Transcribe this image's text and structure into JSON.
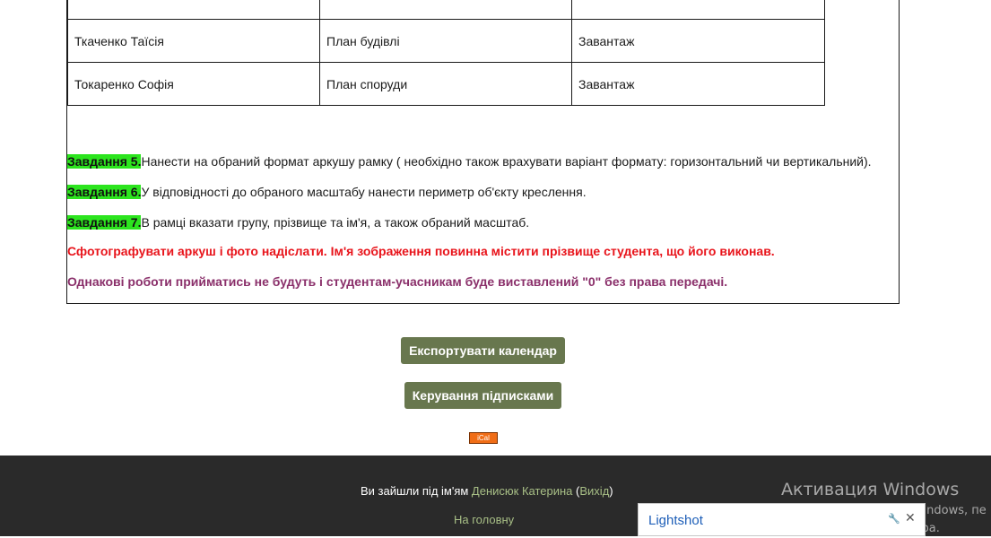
{
  "table": {
    "rows": [
      {
        "name": "",
        "task": "",
        "file": ""
      },
      {
        "name": "Ткаченко Таїсія",
        "task": "План будівлі",
        "file": "Завантаж"
      },
      {
        "name": "Токаренко Софія",
        "task": "План споруди",
        "file": "Завантаж"
      }
    ]
  },
  "tasks": [
    {
      "label": "Завдання 5.",
      "text": "Нанести на обраний формат аркушу рамку ( необхідно також врахувати варіант формату: горизонтальний чи вертикальний)."
    },
    {
      "label": "Завдання 6.",
      "text": "У відповідності до обраного масштабу нанести периметр об'єкту креслення."
    },
    {
      "label": "Завдання 7.",
      "text": "В рамці вказати групу, прізвище та ім'я, а також обраний масштаб."
    }
  ],
  "notes": {
    "red": "Сфотографувати аркуш і фото надіслати. Ім'я  зображення повинна містити прізвище студента, що його виконав.",
    "purple": "Однакові роботи прийматись не будуть і студентам-учасникам буде виставлений \"0\" без права передачі."
  },
  "buttons": {
    "export_calendar": "Експортувати календар",
    "manage_subscriptions": "Керування підписками",
    "ical": "iCal"
  },
  "footer": {
    "logged_in_prefix": "Ви зайшли під ім'ям",
    "user_name": "Денисюк Катерина",
    "open_paren": "(",
    "logout": "Вихід",
    "close_paren": ")",
    "home": "На головну"
  },
  "overlay": {
    "activation_title": "Активация Windows",
    "activation_sub_line1": "Чтобы активировать Windows, пе",
    "activation_sub_line2": "параметрам компьютера.",
    "lightshot_title": "Lightshot"
  },
  "colors": {
    "task_label_bg": "#2ce51e",
    "red_note": "#e8141b",
    "purple_note": "#8a2f6a",
    "button_bg": "#68774e",
    "footer_bg": "#2a2a2a",
    "footer_link": "#a8bf86"
  }
}
